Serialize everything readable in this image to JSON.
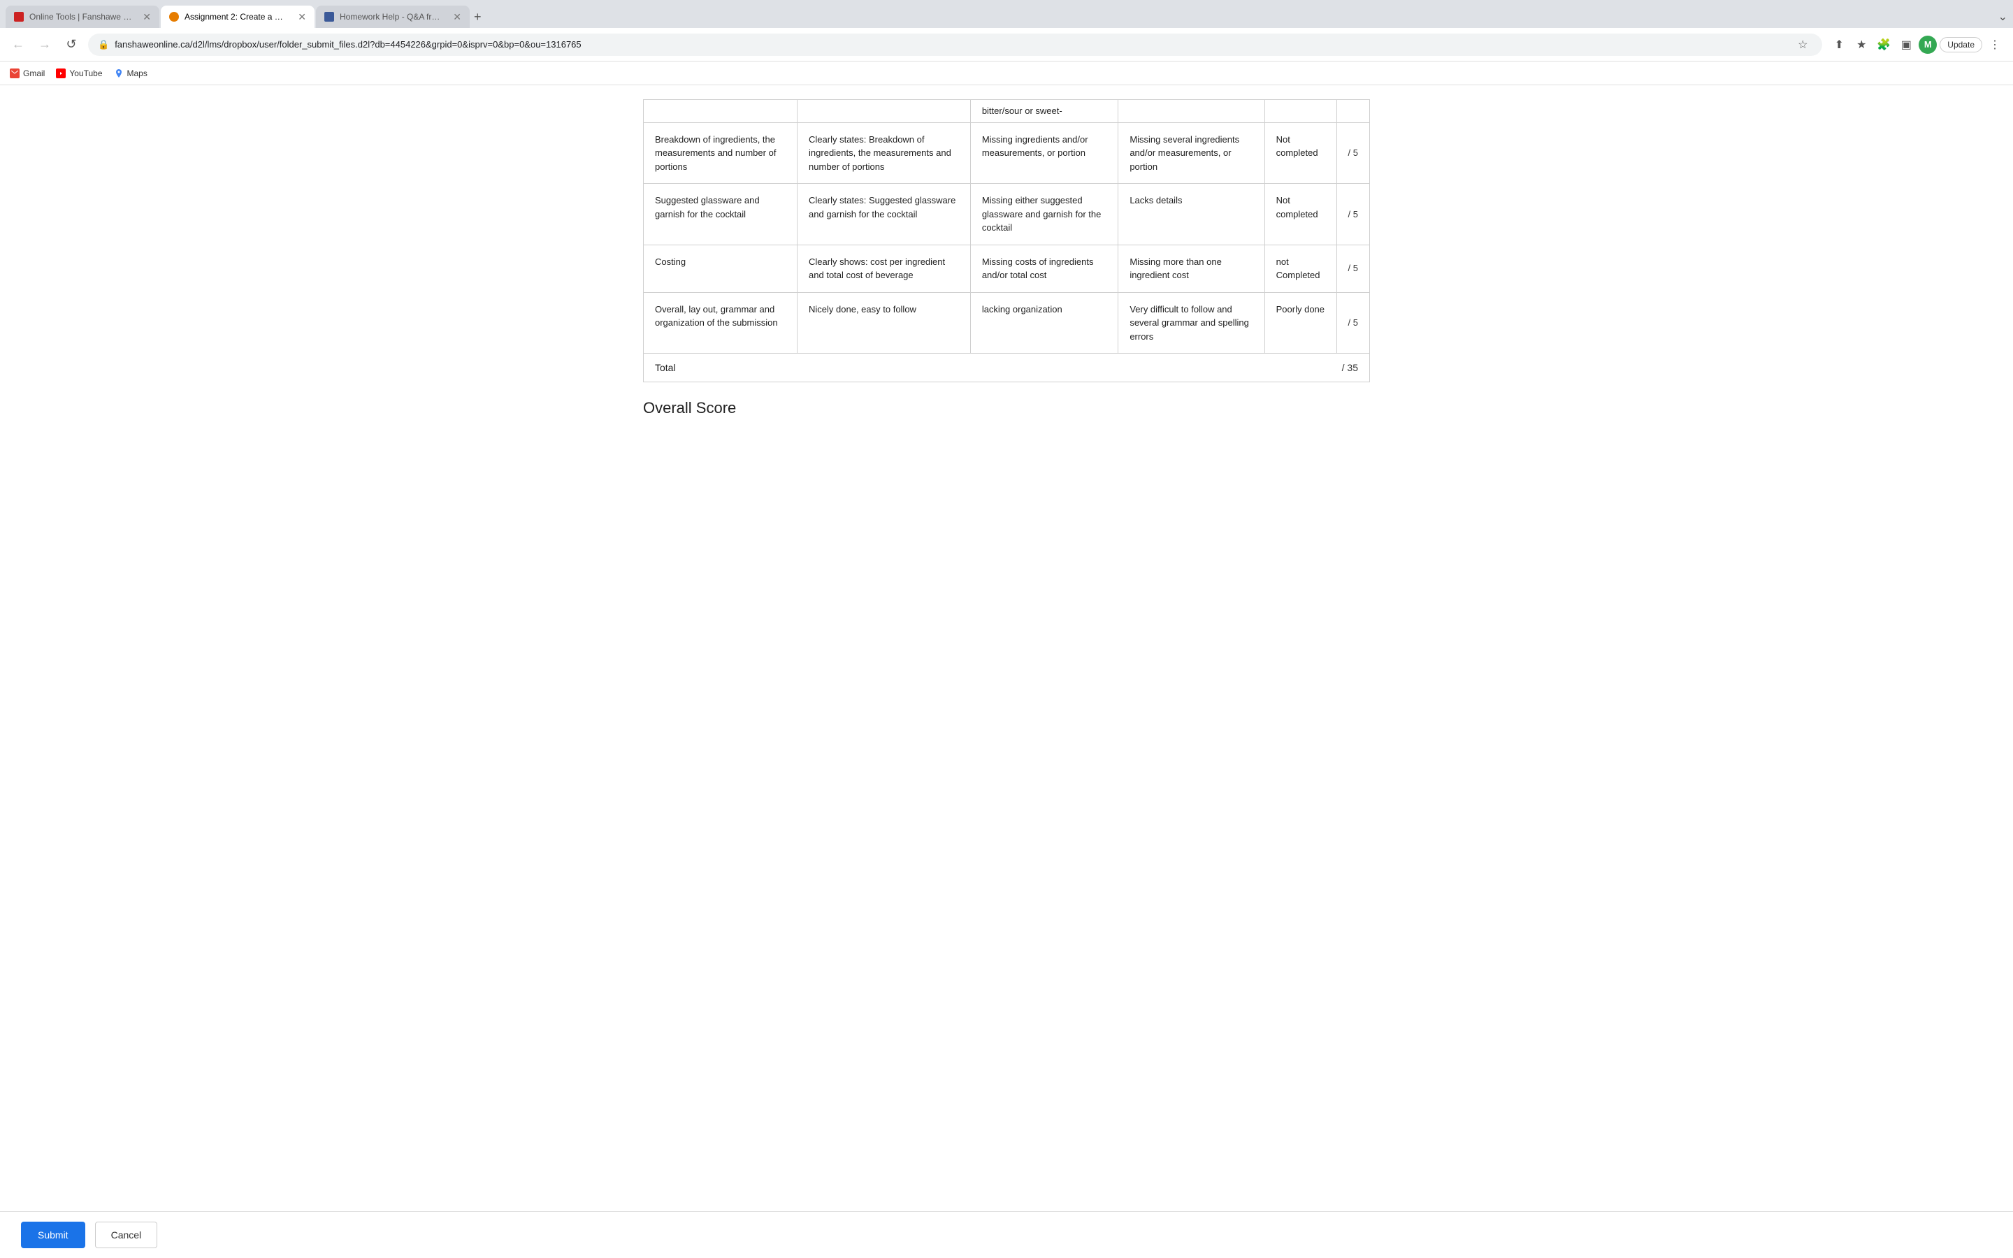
{
  "browser": {
    "tabs": [
      {
        "id": "tab1",
        "title": "Online Tools | Fanshawe Colle...",
        "favicon_type": "fanshawe",
        "active": false
      },
      {
        "id": "tab2",
        "title": "Assignment 2: Create a Cockta...",
        "favicon_type": "assignment",
        "active": true
      },
      {
        "id": "tab3",
        "title": "Homework Help - Q&A from O...",
        "favicon_type": "homework",
        "active": false
      }
    ],
    "address": "fanshaweonline.ca/d2l/lms/dropbox/user/folder_submit_files.d2l?db=4454226&grpid=0&isprv=0&bp=0&ou=1316765",
    "profile_initial": "M",
    "update_label": "Update",
    "bookmarks": [
      {
        "label": "Gmail",
        "type": "gmail"
      },
      {
        "label": "YouTube",
        "type": "youtube"
      },
      {
        "label": "Maps",
        "type": "maps"
      }
    ]
  },
  "table": {
    "partial_top_cell": "bitter/sour or sweet-",
    "rows": [
      {
        "criterion": "Breakdown of ingredients, the measurements and number of portions",
        "excellent": "Clearly states: Breakdown of ingredients, the measurements and number of portions",
        "partial": "Missing ingredients and/or measurements, or portion",
        "minimal": "Missing several ingredients and/or measurements, or portion",
        "not_done": "Not completed",
        "score": "/ 5"
      },
      {
        "criterion": "Suggested glassware and garnish for the cocktail",
        "excellent": "Clearly states: Suggested glassware and garnish for the cocktail",
        "partial": "Missing either suggested glassware and garnish for the cocktail",
        "minimal": "Lacks details",
        "not_done": "Not completed",
        "score": "/ 5"
      },
      {
        "criterion": "Costing",
        "excellent": "Clearly shows:  cost per ingredient and  total cost of beverage",
        "partial": "Missing costs of ingredients and/or total cost",
        "minimal": "Missing more than one ingredient cost",
        "not_done": "not Completed",
        "score": "/ 5"
      },
      {
        "criterion": "Overall, lay out, grammar and organization of the submission",
        "excellent": "Nicely done, easy to follow",
        "partial": "lacking organization",
        "minimal": "Very difficult to follow and several grammar and spelling errors",
        "not_done": "Poorly done",
        "score": "/ 5"
      }
    ],
    "total_label": "Total",
    "total_score": "/ 35"
  },
  "overall_score_heading": "Overall Score",
  "buttons": {
    "submit": "Submit",
    "cancel": "Cancel"
  }
}
